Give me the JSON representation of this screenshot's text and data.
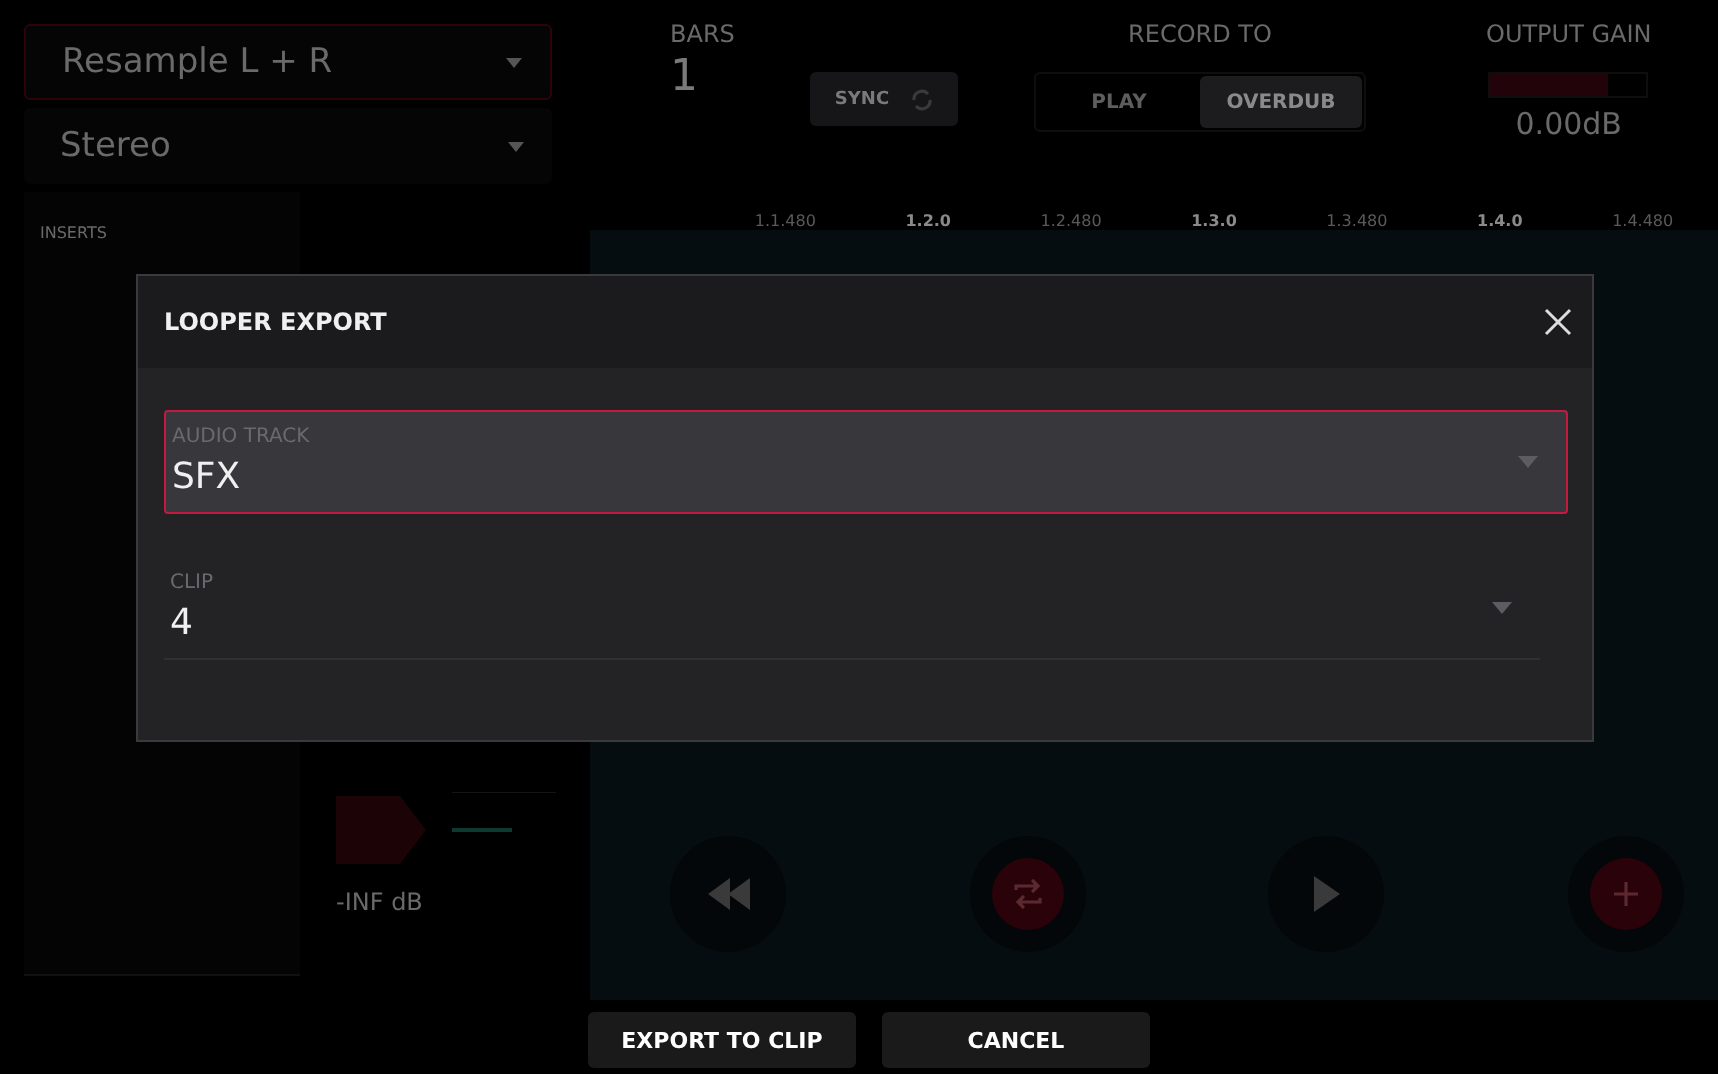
{
  "input": {
    "source": "Resample L + R",
    "mode": "Stereo"
  },
  "inserts": {
    "title": "INSERTS"
  },
  "meter": {
    "reading": "-INF dB"
  },
  "bars": {
    "label": "BARS",
    "value": "1"
  },
  "sync": {
    "label": "SYNC"
  },
  "record_to": {
    "label": "RECORD TO",
    "options": [
      {
        "label": "PLAY",
        "selected": false
      },
      {
        "label": "OVERDUB",
        "selected": true
      }
    ]
  },
  "output_gain": {
    "label": "OUTPUT GAIN",
    "level": 0.75,
    "reading": "0.00dB"
  },
  "ruler": [
    {
      "label": "1.1.480",
      "major": false
    },
    {
      "label": "1.2.0",
      "major": true
    },
    {
      "label": "1.2.480",
      "major": false
    },
    {
      "label": "1.3.0",
      "major": true
    },
    {
      "label": "1.3.480",
      "major": false
    },
    {
      "label": "1.4.0",
      "major": true
    },
    {
      "label": "1.4.480",
      "major": false
    }
  ],
  "transport": [
    {
      "kind": "rewind"
    },
    {
      "kind": "loop"
    },
    {
      "kind": "play"
    },
    {
      "kind": "add"
    }
  ],
  "dialog": {
    "title": "LOOPER EXPORT",
    "fields": [
      {
        "label": "AUDIO TRACK",
        "value": "SFX",
        "selected": true
      },
      {
        "label": "CLIP",
        "value": "4",
        "selected": false
      }
    ]
  },
  "buttons": [
    "EXPORT TO CLIP",
    "CANCEL"
  ]
}
